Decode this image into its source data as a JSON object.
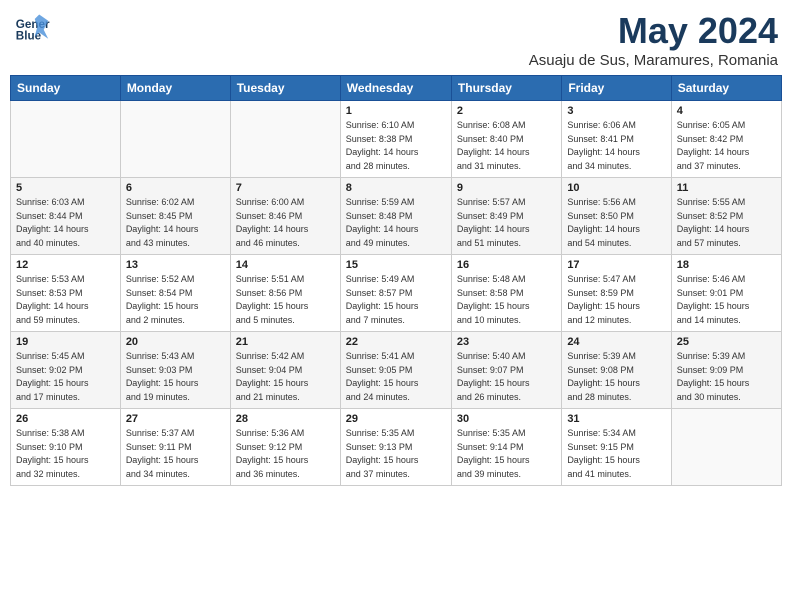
{
  "header": {
    "logo_line1": "General",
    "logo_line2": "Blue",
    "month_title": "May 2024",
    "location": "Asuaju de Sus, Maramures, Romania"
  },
  "weekdays": [
    "Sunday",
    "Monday",
    "Tuesday",
    "Wednesday",
    "Thursday",
    "Friday",
    "Saturday"
  ],
  "weeks": [
    [
      {
        "day": "",
        "info": ""
      },
      {
        "day": "",
        "info": ""
      },
      {
        "day": "",
        "info": ""
      },
      {
        "day": "1",
        "info": "Sunrise: 6:10 AM\nSunset: 8:38 PM\nDaylight: 14 hours\nand 28 minutes."
      },
      {
        "day": "2",
        "info": "Sunrise: 6:08 AM\nSunset: 8:40 PM\nDaylight: 14 hours\nand 31 minutes."
      },
      {
        "day": "3",
        "info": "Sunrise: 6:06 AM\nSunset: 8:41 PM\nDaylight: 14 hours\nand 34 minutes."
      },
      {
        "day": "4",
        "info": "Sunrise: 6:05 AM\nSunset: 8:42 PM\nDaylight: 14 hours\nand 37 minutes."
      }
    ],
    [
      {
        "day": "5",
        "info": "Sunrise: 6:03 AM\nSunset: 8:44 PM\nDaylight: 14 hours\nand 40 minutes."
      },
      {
        "day": "6",
        "info": "Sunrise: 6:02 AM\nSunset: 8:45 PM\nDaylight: 14 hours\nand 43 minutes."
      },
      {
        "day": "7",
        "info": "Sunrise: 6:00 AM\nSunset: 8:46 PM\nDaylight: 14 hours\nand 46 minutes."
      },
      {
        "day": "8",
        "info": "Sunrise: 5:59 AM\nSunset: 8:48 PM\nDaylight: 14 hours\nand 49 minutes."
      },
      {
        "day": "9",
        "info": "Sunrise: 5:57 AM\nSunset: 8:49 PM\nDaylight: 14 hours\nand 51 minutes."
      },
      {
        "day": "10",
        "info": "Sunrise: 5:56 AM\nSunset: 8:50 PM\nDaylight: 14 hours\nand 54 minutes."
      },
      {
        "day": "11",
        "info": "Sunrise: 5:55 AM\nSunset: 8:52 PM\nDaylight: 14 hours\nand 57 minutes."
      }
    ],
    [
      {
        "day": "12",
        "info": "Sunrise: 5:53 AM\nSunset: 8:53 PM\nDaylight: 14 hours\nand 59 minutes."
      },
      {
        "day": "13",
        "info": "Sunrise: 5:52 AM\nSunset: 8:54 PM\nDaylight: 15 hours\nand 2 minutes."
      },
      {
        "day": "14",
        "info": "Sunrise: 5:51 AM\nSunset: 8:56 PM\nDaylight: 15 hours\nand 5 minutes."
      },
      {
        "day": "15",
        "info": "Sunrise: 5:49 AM\nSunset: 8:57 PM\nDaylight: 15 hours\nand 7 minutes."
      },
      {
        "day": "16",
        "info": "Sunrise: 5:48 AM\nSunset: 8:58 PM\nDaylight: 15 hours\nand 10 minutes."
      },
      {
        "day": "17",
        "info": "Sunrise: 5:47 AM\nSunset: 8:59 PM\nDaylight: 15 hours\nand 12 minutes."
      },
      {
        "day": "18",
        "info": "Sunrise: 5:46 AM\nSunset: 9:01 PM\nDaylight: 15 hours\nand 14 minutes."
      }
    ],
    [
      {
        "day": "19",
        "info": "Sunrise: 5:45 AM\nSunset: 9:02 PM\nDaylight: 15 hours\nand 17 minutes."
      },
      {
        "day": "20",
        "info": "Sunrise: 5:43 AM\nSunset: 9:03 PM\nDaylight: 15 hours\nand 19 minutes."
      },
      {
        "day": "21",
        "info": "Sunrise: 5:42 AM\nSunset: 9:04 PM\nDaylight: 15 hours\nand 21 minutes."
      },
      {
        "day": "22",
        "info": "Sunrise: 5:41 AM\nSunset: 9:05 PM\nDaylight: 15 hours\nand 24 minutes."
      },
      {
        "day": "23",
        "info": "Sunrise: 5:40 AM\nSunset: 9:07 PM\nDaylight: 15 hours\nand 26 minutes."
      },
      {
        "day": "24",
        "info": "Sunrise: 5:39 AM\nSunset: 9:08 PM\nDaylight: 15 hours\nand 28 minutes."
      },
      {
        "day": "25",
        "info": "Sunrise: 5:39 AM\nSunset: 9:09 PM\nDaylight: 15 hours\nand 30 minutes."
      }
    ],
    [
      {
        "day": "26",
        "info": "Sunrise: 5:38 AM\nSunset: 9:10 PM\nDaylight: 15 hours\nand 32 minutes."
      },
      {
        "day": "27",
        "info": "Sunrise: 5:37 AM\nSunset: 9:11 PM\nDaylight: 15 hours\nand 34 minutes."
      },
      {
        "day": "28",
        "info": "Sunrise: 5:36 AM\nSunset: 9:12 PM\nDaylight: 15 hours\nand 36 minutes."
      },
      {
        "day": "29",
        "info": "Sunrise: 5:35 AM\nSunset: 9:13 PM\nDaylight: 15 hours\nand 37 minutes."
      },
      {
        "day": "30",
        "info": "Sunrise: 5:35 AM\nSunset: 9:14 PM\nDaylight: 15 hours\nand 39 minutes."
      },
      {
        "day": "31",
        "info": "Sunrise: 5:34 AM\nSunset: 9:15 PM\nDaylight: 15 hours\nand 41 minutes."
      },
      {
        "day": "",
        "info": ""
      }
    ]
  ]
}
